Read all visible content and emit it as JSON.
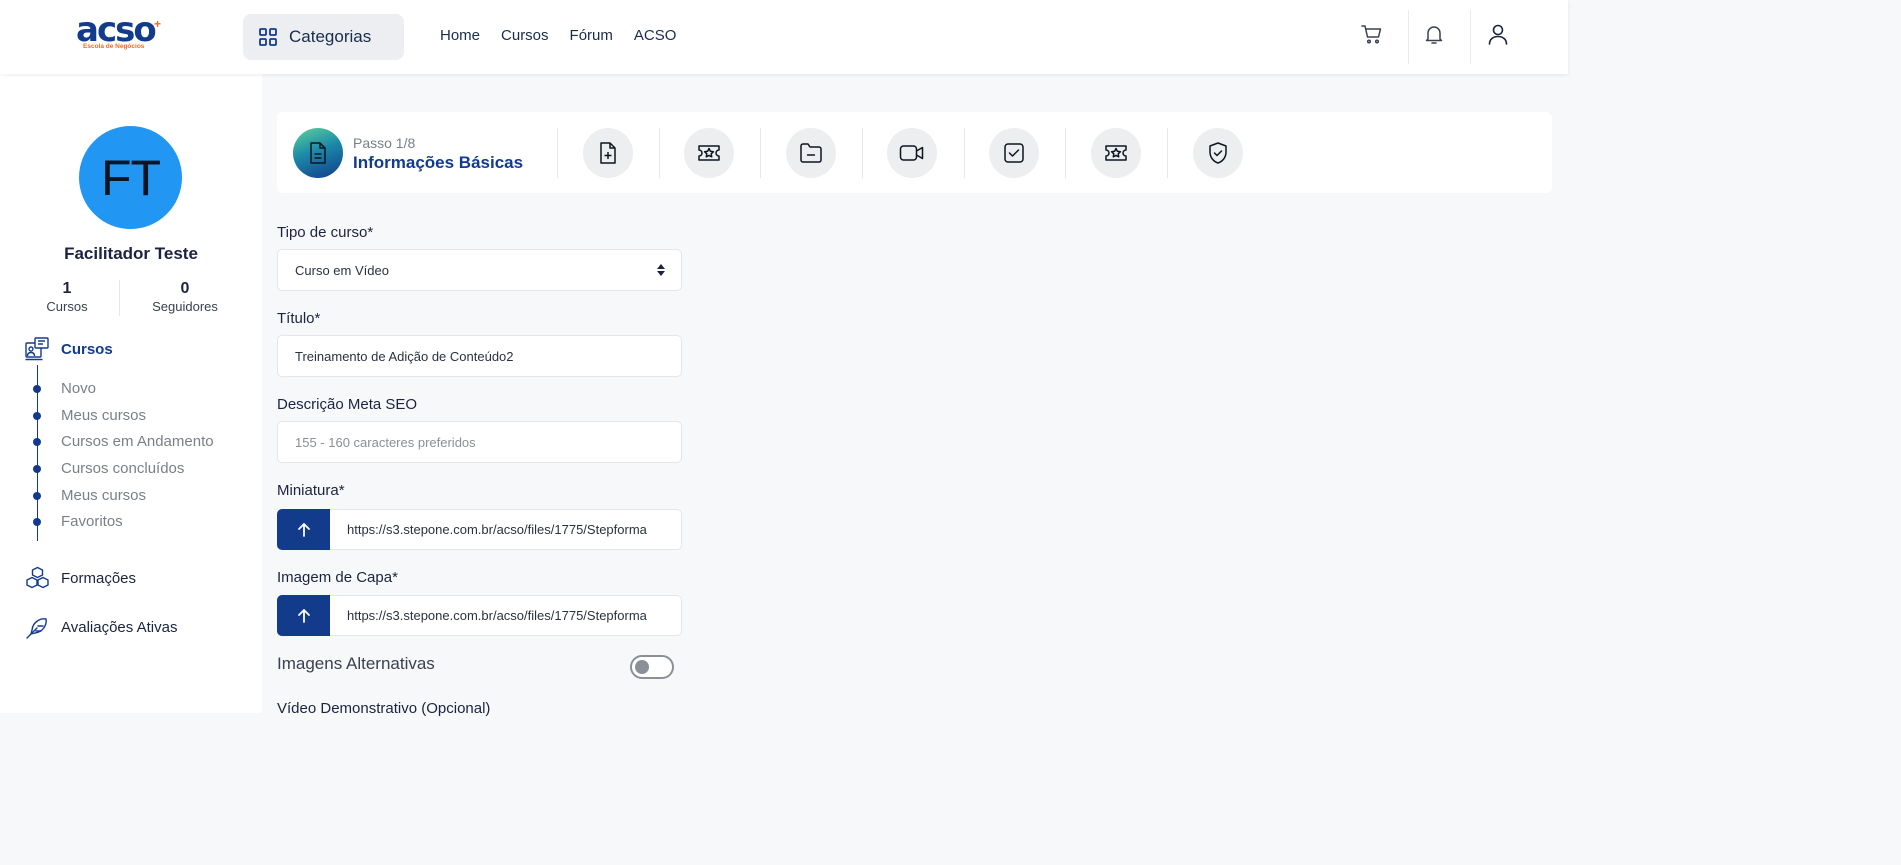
{
  "brand": {
    "logo_text": "acso",
    "logo_subtitle": "Escola de Negócios"
  },
  "header": {
    "categories_label": "Categorias",
    "nav": [
      "Home",
      "Cursos",
      "Fórum",
      "ACSO"
    ],
    "icons": [
      "grid-icon",
      "cart-icon",
      "bell-icon",
      "user-icon"
    ]
  },
  "sidebar": {
    "avatar_initials": "FT",
    "user_name": "Facilitador Teste",
    "stats": [
      {
        "value": "1",
        "label": "Cursos"
      },
      {
        "value": "0",
        "label": "Seguidores"
      }
    ],
    "menu": [
      {
        "label": "Cursos",
        "icon": "course-board-icon",
        "active": true
      },
      {
        "label": "Formações",
        "icon": "cubes-icon",
        "active": false
      },
      {
        "label": "Avaliações Ativas",
        "icon": "feather-icon",
        "active": false
      }
    ],
    "submenu": [
      "Novo",
      "Meus cursos",
      "Cursos em Andamento",
      "Cursos concluídos",
      "Meus cursos",
      "Favoritos"
    ]
  },
  "stepper": {
    "counter": "Passo 1/8",
    "title": "Informações Básicas",
    "active_icon": "document-icon",
    "step_icons": [
      "file-plus-icon",
      "ticket-star-icon",
      "folder-minus-icon",
      "video-icon",
      "checkbox-icon",
      "ticket-star-icon",
      "shield-check-icon"
    ]
  },
  "form": {
    "course_type": {
      "label": "Tipo de curso*",
      "value": "Curso em Vídeo"
    },
    "title": {
      "label": "Título*",
      "value": "Treinamento de Adição de Conteúdo2"
    },
    "seo": {
      "label": "Descrição Meta SEO",
      "placeholder": "155 - 160 caracteres preferidos"
    },
    "thumbnail": {
      "label": "Miniatura*",
      "value": "https://s3.stepone.com.br/acso/files/1775/Stepforma"
    },
    "cover": {
      "label": "Imagem de Capa*",
      "value": "https://s3.stepone.com.br/acso/files/1775/Stepforma"
    },
    "alt_images": {
      "label": "Imagens Alternativas",
      "enabled": false
    },
    "demo_video": {
      "label": "Vídeo Demonstrativo (Opcional)"
    }
  },
  "colors": {
    "primary": "#123b8c",
    "avatar": "#2196f3",
    "accent_orange": "#f06b22"
  }
}
